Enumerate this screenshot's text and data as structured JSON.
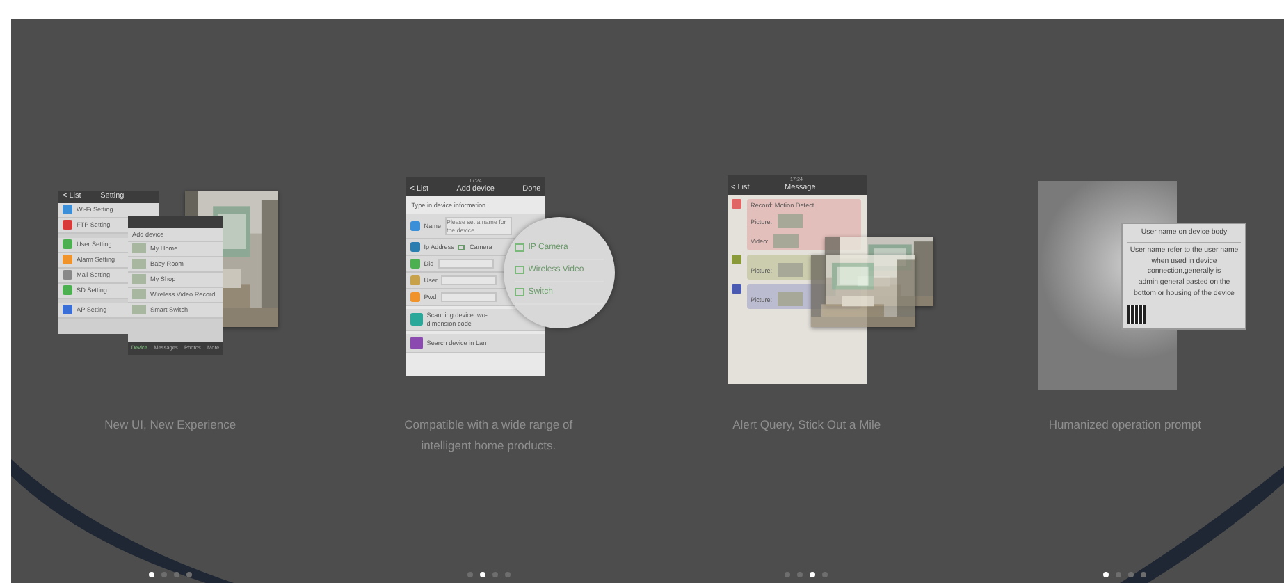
{
  "slides": [
    {
      "caption": "New UI, New Experience",
      "dots": [
        {
          "selected": true
        },
        {
          "selected": false
        },
        {
          "selected": false
        },
        {
          "selected": false
        }
      ],
      "screen": {
        "kind": "settings",
        "back": "< List",
        "title": "Setting",
        "items": [
          {
            "label": "Wi-Fi Setting",
            "color": "#3a8fd8"
          },
          {
            "label": "FTP Setting",
            "color": "#d83a3a"
          },
          {
            "label": "User Setting",
            "color": "#4caf50"
          },
          {
            "label": "Alarm Setting",
            "color": "#f0932b"
          },
          {
            "label": "Mail Setting",
            "color": "#888888"
          },
          {
            "label": "SD Setting",
            "color": "#4caf50"
          },
          {
            "label": "AP Setting",
            "color": "#3a6fd8"
          }
        ],
        "devices_title": "Add device",
        "devices": [
          {
            "label": "My Home"
          },
          {
            "label": "Baby Room"
          },
          {
            "label": "My Shop"
          },
          {
            "label": "Wireless Video Record"
          },
          {
            "label": "Smart Switch"
          }
        ],
        "tabs": [
          {
            "label": "Device",
            "selected": true
          },
          {
            "label": "Messages",
            "selected": false
          },
          {
            "label": "Photos",
            "selected": false
          },
          {
            "label": "More",
            "selected": false
          }
        ]
      }
    },
    {
      "caption": "Compatible with a wide range of intelligent home products.",
      "dots": [
        {
          "selected": false
        },
        {
          "selected": true
        },
        {
          "selected": false
        },
        {
          "selected": false
        }
      ],
      "screen": {
        "kind": "add_device",
        "time": "17:24",
        "back": "< List",
        "title": "Add device",
        "action": "Done",
        "section": "Type in device information",
        "fields": [
          {
            "label": "Name",
            "placeholder": "Please set a name for the device",
            "color": "#3a8fd8"
          },
          {
            "label": "Ip Address",
            "option": "Camera",
            "color": "#2a7fb0"
          },
          {
            "label": "Did",
            "color": "#4caf50"
          },
          {
            "label": "User",
            "color": "#c8a24a"
          },
          {
            "label": "Pwd",
            "color": "#f0932b"
          }
        ],
        "links": [
          {
            "label": "Scanning device two-dimension code",
            "color": "#2aa89a"
          },
          {
            "label": "Search device in Lan",
            "color": "#8a4ab0"
          }
        ],
        "magnifier": [
          "IP Camera",
          "Wireless Video",
          "Switch"
        ]
      }
    },
    {
      "caption": "Alert Query, Stick Out a Mile",
      "dots": [
        {
          "selected": false
        },
        {
          "selected": false
        },
        {
          "selected": true
        },
        {
          "selected": false
        }
      ],
      "screen": {
        "kind": "messages",
        "time": "17:24",
        "back": "< List",
        "title": "Message",
        "messages": [
          {
            "color": "#e06666",
            "text": "Record: Motion Detect",
            "media": [
              "Picture:",
              "Video:"
            ]
          },
          {
            "color": "#8a9a3a",
            "media": [
              "Picture:"
            ]
          },
          {
            "color": "#4a5ab0",
            "media": [
              "Picture:"
            ]
          }
        ]
      }
    },
    {
      "caption": "Humanized operation prompt",
      "dots": [
        {
          "selected": true
        },
        {
          "selected": false
        },
        {
          "selected": false
        },
        {
          "selected": false
        }
      ],
      "screen": {
        "kind": "prompt",
        "title": "User name on device body",
        "body": "User name refer to the user name when used in device connection,generally is admin,general pasted on the bottom or housing of the device"
      }
    }
  ]
}
